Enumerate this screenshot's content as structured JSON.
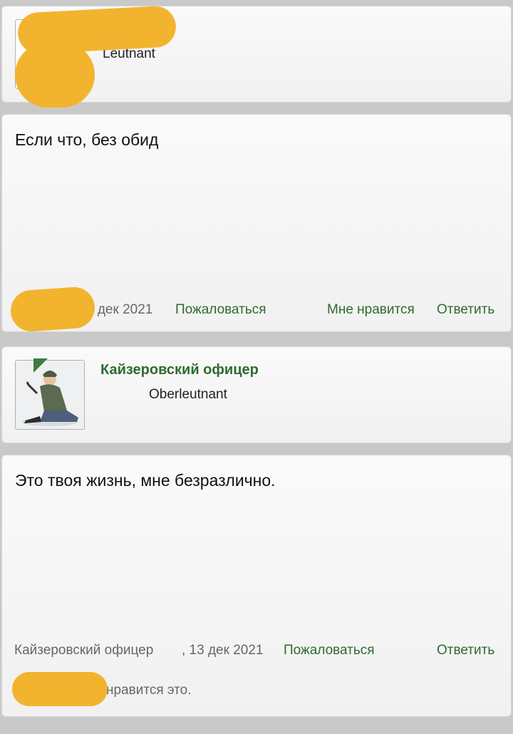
{
  "posts": [
    {
      "header": {
        "rank": "Leutnant"
      },
      "message": "Если что, без обид",
      "footer": {
        "date_fragment": "3 дек 2021",
        "report": "Пожаловаться",
        "like": "Мне нравится",
        "reply": "Ответить"
      }
    },
    {
      "header": {
        "username": "Кайзеровский офицер",
        "rank": "Oberleutnant"
      },
      "message": "Это твоя жизнь, мне безразлично.",
      "footer": {
        "author": "Кайзеровский офицер",
        "date": ", 13 дек 2021",
        "report": "Пожаловаться",
        "reply": "Ответить"
      },
      "likes_text": "нравится это."
    }
  ],
  "colors": {
    "accent": "#2f6b2f",
    "redaction": "#f2b42f",
    "background": "#c9c9c9"
  },
  "icons": {
    "avatar2": "soldier-avatar-icon"
  }
}
